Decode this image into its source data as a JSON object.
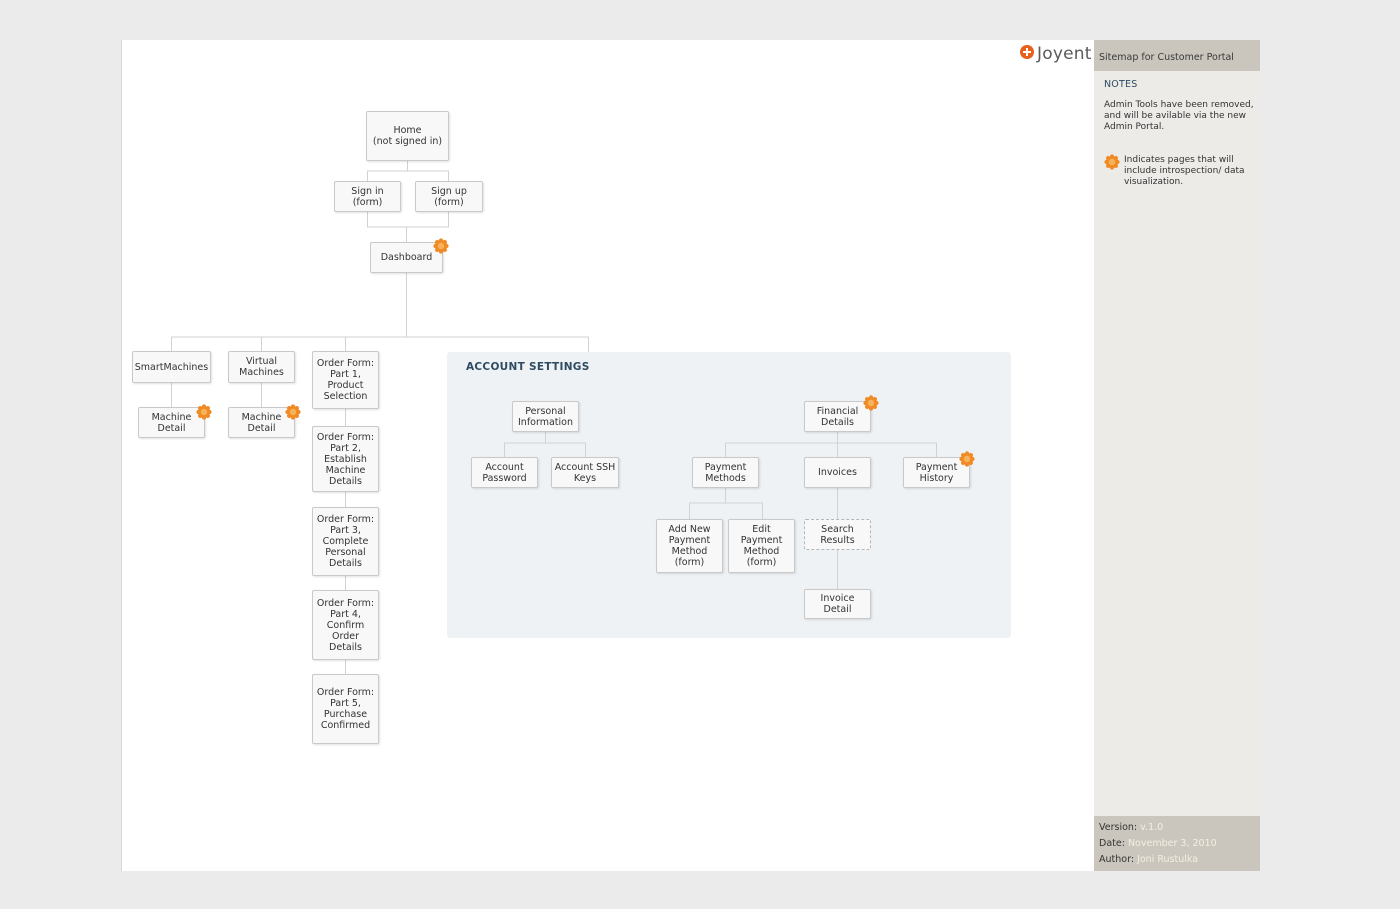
{
  "logo": {
    "text": "Joyent"
  },
  "sidebar": {
    "title": "Sitemap for Customer Portal",
    "notes_heading": "NOTES",
    "note_admin": "Admin Tools have been removed, and will be avilable via the new Admin Portal.",
    "note_legend": "Indicates pages that will include introspection/ data visualization.",
    "legend_icon": "orange-starburst-icon",
    "version_label": "Version:",
    "version": "v.1.0",
    "date_label": "Date:",
    "date": "November 3, 2010",
    "author_label": "Author:",
    "author": "Joni Rustulka"
  },
  "diagram": {
    "accent_color": "#f08a24",
    "group_title": "ACCOUNT SETTINGS",
    "nodes": {
      "home": "Home\n(not signed in)",
      "signin": "Sign in\n(form)",
      "signup": "Sign up\n(form)",
      "dashboard": "Dashboard",
      "smartmachines": "SmartMachines",
      "virtual_machines": "Virtual\nMachines",
      "machine_detail_1": "Machine\nDetail",
      "machine_detail_2": "Machine\nDetail",
      "order_1": "Order Form:\nPart 1,\nProduct\nSelection",
      "order_2": "Order Form:\nPart 2,\nEstablish\nMachine\nDetails",
      "order_3": "Order Form:\nPart 3,\nComplete\nPersonal\nDetails",
      "order_4": "Order Form:\nPart 4,\nConfirm\nOrder\nDetails",
      "order_5": "Order Form:\nPart 5,\nPurchase\nConfirmed",
      "personal_info": "Personal\nInformation",
      "account_password": "Account\nPassword",
      "account_ssh": "Account SSH\nKeys",
      "financial": "Financial\nDetails",
      "payment_methods": "Payment\nMethods",
      "invoices": "Invoices",
      "payment_history": "Payment\nHistory",
      "add_payment": "Add New\nPayment\nMethod\n(form)",
      "edit_payment": "Edit\nPayment\nMethod\n(form)",
      "search_results": "Search\nResults",
      "invoice_detail": "Invoice\nDetail"
    }
  }
}
